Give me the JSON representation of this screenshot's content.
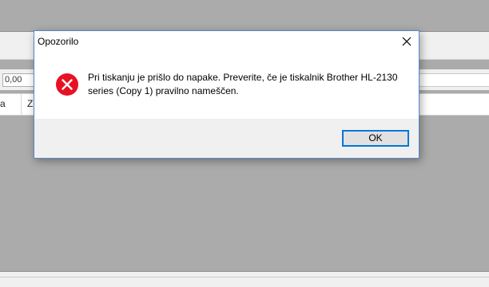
{
  "background_app": {
    "numeric_field_value": "0,00",
    "column_headers": [
      "a",
      "Z"
    ]
  },
  "dialog": {
    "title": "Opozorilo",
    "message": "Pri tiskanju je prišlo do napake. Preverite, če je tiskalnik Brother HL-2130 series (Copy 1) pravilno nameščen.",
    "ok_label": "OK",
    "icon": "error-icon",
    "close_icon": "close-icon"
  },
  "colors": {
    "error_red": "#e81123",
    "accent_blue": "#0078d7",
    "desktop_gray": "#ababab"
  }
}
